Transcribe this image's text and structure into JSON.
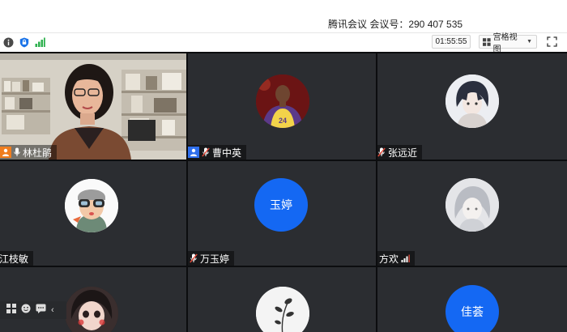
{
  "meeting": {
    "title": "腾讯会议 会议号：290 407 535",
    "timer": "01:55:55",
    "view_label": "宫格视图"
  },
  "participants": [
    {
      "name": "林杜鹃",
      "role": "host",
      "avatar": "webcam-video"
    },
    {
      "name": "曹中英",
      "role": "cohost",
      "avatar": "basketball-player-photo"
    },
    {
      "name": "张远近",
      "role": "member",
      "avatar": "anime-boy-portrait"
    },
    {
      "name": "江枝敏",
      "role": "member",
      "avatar": "cartoon-goggles-character"
    },
    {
      "name": "万玉婷",
      "role": "member",
      "avatar_text": "玉婷"
    },
    {
      "name": "方欢",
      "role": "member",
      "avatar": "anime-girl-sketch",
      "signal": "signal-bars-icon"
    },
    {
      "name": "",
      "role": "member",
      "avatar": "girl-face-photo"
    },
    {
      "name": "",
      "role": "member",
      "avatar": "plant-sketch"
    },
    {
      "name": "",
      "role": "member",
      "avatar_text": "佳荟"
    }
  ],
  "colors": {
    "accent_blue": "#1468f3",
    "host_orange": "#f07d1e",
    "tile_bg": "#2b2d31",
    "mic_red": "#e24b3b"
  }
}
